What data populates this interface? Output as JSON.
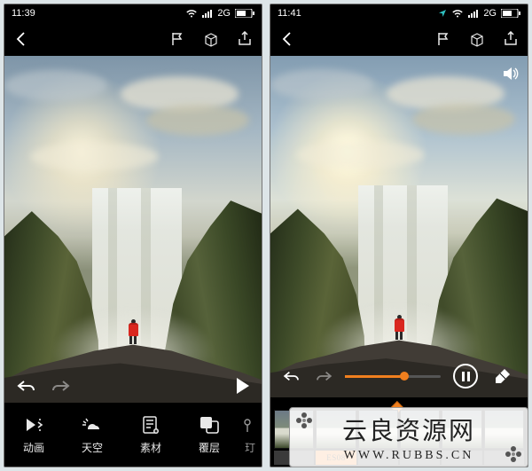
{
  "left": {
    "status": {
      "time": "11:39",
      "network": "2G"
    },
    "toolbar": {
      "animation": "动画",
      "sky": "天空",
      "material": "素材",
      "overlay": "覆层",
      "more": "玎"
    }
  },
  "right": {
    "status": {
      "time": "11:41",
      "network": "2G"
    },
    "timeline_progress_pct": 62,
    "filmstrip_labels": [
      "",
      "ES08",
      "",
      "",
      "",
      ""
    ]
  },
  "icons": {
    "back": "back-icon",
    "flag": "flag-icon",
    "box": "box-icon",
    "share": "share-icon",
    "undo": "undo-icon",
    "redo": "redo-icon",
    "play": "play-icon",
    "pause": "pause-icon",
    "eraser": "eraser-icon",
    "sound": "sound-icon"
  },
  "watermark": {
    "title": "云良资源网",
    "url": "WWW.RUBBS.CN"
  }
}
